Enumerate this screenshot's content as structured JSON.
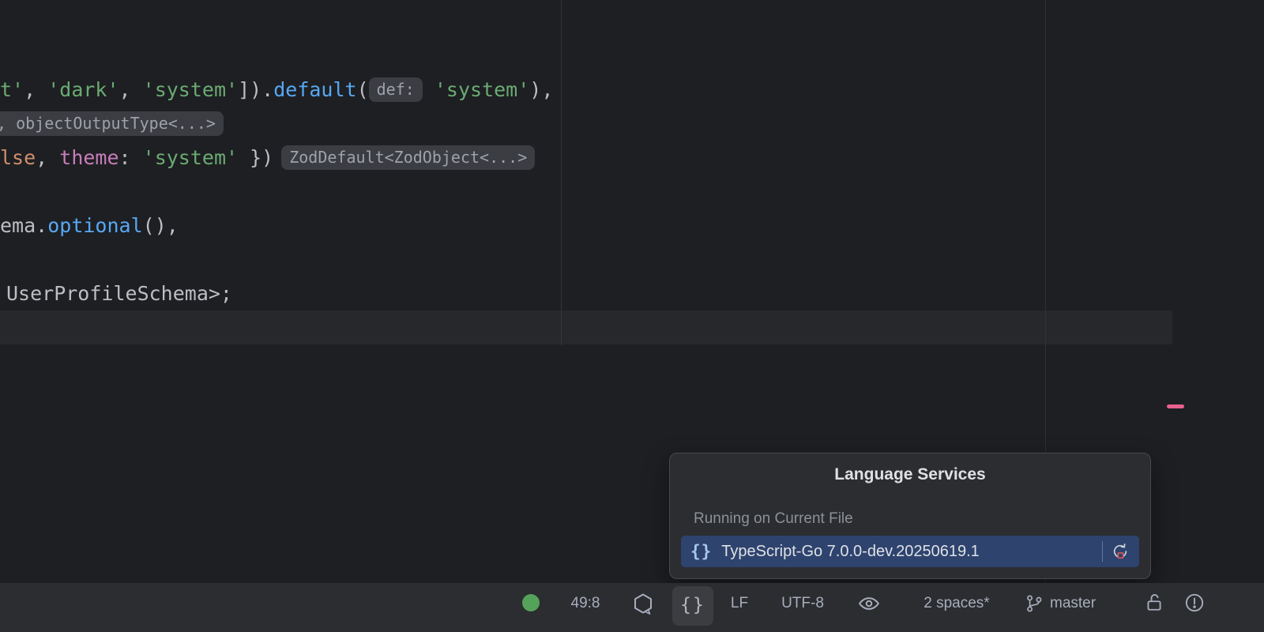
{
  "colors": {
    "editor_bg": "#1E1F22",
    "panel_bg": "#2B2D30",
    "panel_border": "#47494E",
    "selection_blue": "#2E436E",
    "string_green": "#6AAB73",
    "function_blue": "#56A8F5",
    "keyword_orange": "#CF8E6D",
    "property_purple": "#C77DBB",
    "code_default": "#BCBEC4",
    "inlay_bg": "#3B3D42",
    "inlay_fg": "#9DA2AB",
    "status_fg": "#A8ADBD",
    "status_green": "#55A25A",
    "stripe_pink": "#E7618F",
    "restart_red": "#DB5C5C",
    "caret_line_bg": "#26282C",
    "guide_line": "#33353A",
    "popup_title_fg": "#DFE1E5",
    "popup_label_fg": "#8C9199",
    "popup_text_fg": "#DFE1E5",
    "widget_active_bg": "#3B3D41",
    "braces_blue": "#A9C7F0"
  },
  "editor": {
    "rows": [
      {
        "segments": []
      },
      {
        "segments": []
      },
      {
        "segments": [
          {
            "text": "t'",
            "style": "string"
          },
          {
            "text": ", ",
            "style": "plain"
          },
          {
            "text": "'dark'",
            "style": "string"
          },
          {
            "text": ", ",
            "style": "plain"
          },
          {
            "text": "'system'",
            "style": "string"
          },
          {
            "text": "]).",
            "style": "plain"
          },
          {
            "text": "default",
            "style": "function"
          },
          {
            "text": "(",
            "style": "plain"
          },
          {
            "text": "def:",
            "inlay": "parameter-hint"
          },
          {
            "text": " ",
            "style": "plain"
          },
          {
            "text": "'system'",
            "style": "string"
          },
          {
            "text": "),",
            "style": "plain"
          }
        ]
      },
      {
        "x": -14,
        "segments": [
          {
            "text": ", objectOutputType<...>",
            "inlay": "type-hint"
          }
        ]
      },
      {
        "segments": [
          {
            "text": "lse",
            "style": "keyword"
          },
          {
            "text": ", ",
            "style": "plain"
          },
          {
            "text": "theme",
            "style": "property"
          },
          {
            "text": ": ",
            "style": "plain"
          },
          {
            "text": "'system'",
            "style": "string"
          },
          {
            "text": " })",
            "style": "plain"
          },
          {
            "text": "ZodDefault<ZodObject<...>",
            "inlay": "type-hint",
            "gap": 10
          }
        ]
      },
      {
        "segments": []
      },
      {
        "segments": [
          {
            "text": "ema.",
            "style": "plain"
          },
          {
            "text": "optional",
            "style": "function"
          },
          {
            "text": "(),",
            "style": "plain"
          }
        ]
      },
      {
        "segments": []
      },
      {
        "x": 8,
        "segments": [
          {
            "text": "UserProfileSchema>;",
            "style": "plain"
          }
        ]
      },
      {
        "segments": []
      }
    ]
  },
  "popup": {
    "title": "Language Services",
    "section_label": "Running on Current File",
    "service_name": "TypeScript-Go 7.0.0-dev.20250619.1",
    "braces_glyph": "{}"
  },
  "status_bar": {
    "caret_position": "49:8",
    "line_separator": "LF",
    "encoding": "UTF-8",
    "indent": "2 spaces*",
    "git_branch": "master",
    "braces_glyph": "{}"
  }
}
